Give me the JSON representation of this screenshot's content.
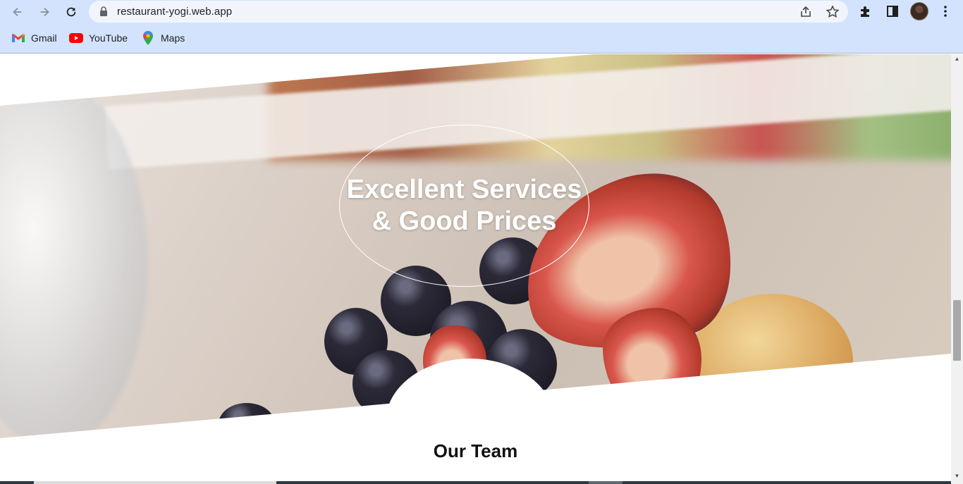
{
  "browser": {
    "url": "restaurant-yogi.web.app",
    "bookmarks": [
      {
        "label": "Gmail",
        "icon": "gmail-icon"
      },
      {
        "label": "YouTube",
        "icon": "youtube-icon"
      },
      {
        "label": "Maps",
        "icon": "maps-icon"
      }
    ]
  },
  "hero": {
    "title_line1": "Excellent Services",
    "title_line2": "& Good Prices"
  },
  "team": {
    "heading": "Our Team"
  },
  "colors": {
    "chrome_bg": "#d3e3fd",
    "omnibox_bg": "#f1f5fb",
    "hero_text": "#ffffff"
  }
}
